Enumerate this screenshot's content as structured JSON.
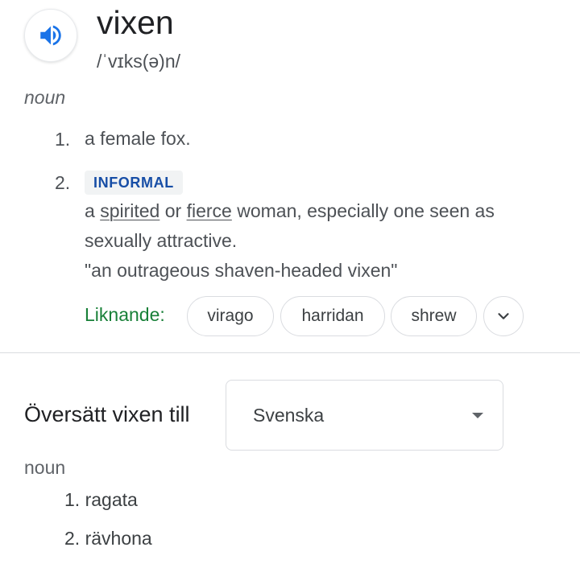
{
  "entry": {
    "word": "vixen",
    "phonetic": "/ˈvɪks(ə)n/",
    "speaker_icon": "volume-up-icon",
    "part_of_speech": "noun"
  },
  "definitions": [
    {
      "number": "1.",
      "text": "a female fox."
    },
    {
      "number": "2.",
      "label": "INFORMAL",
      "text_parts": [
        "a ",
        "spirited",
        " or ",
        "fierce",
        " woman, especially one seen as"
      ],
      "text_line2": "sexually attractive.",
      "example": "\"an outrageous shaven-headed vixen\""
    }
  ],
  "similar": {
    "label": "Liknande:",
    "chips": [
      "virago",
      "harridan",
      "shrew"
    ],
    "more_icon": "chevron-down-icon"
  },
  "translate": {
    "label": "Översätt vixen till",
    "language": "Svenska",
    "part_of_speech": "noun",
    "items": [
      "1. ragata",
      "2. rävhona"
    ]
  },
  "colors": {
    "accent_blue": "#1a73e8",
    "label_blue": "#174ea6",
    "similar_green": "#188038"
  }
}
